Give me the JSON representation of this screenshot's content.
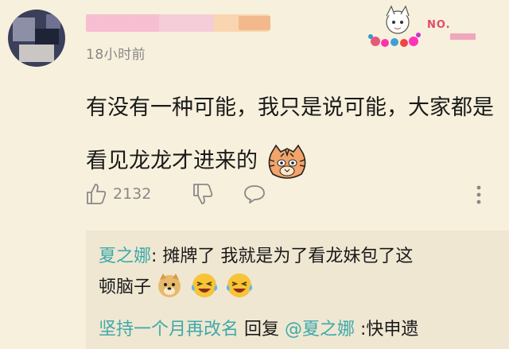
{
  "comment": {
    "timestamp": "18小时前",
    "text_line1": "有没有一种可能，我只是说可能，大家都是",
    "text_line2": "看见龙龙才进来的",
    "likes": "2132"
  },
  "badge": {
    "label": "NO."
  },
  "replies": [
    {
      "user": "夏之娜",
      "sep": ":",
      "text_line1": " 摊牌了 我就是为了看龙妹包了这",
      "text_line2": "顿脑子"
    },
    {
      "user": "坚持一个月再改名",
      "reply_word": " 回复 ",
      "mention": "@夏之娜",
      "text": " :快申遗"
    }
  ],
  "colors": {
    "background": "#f7f0dc",
    "reply_bg": "#efe7d2",
    "link": "#3ea9a9",
    "meta": "#888888"
  }
}
